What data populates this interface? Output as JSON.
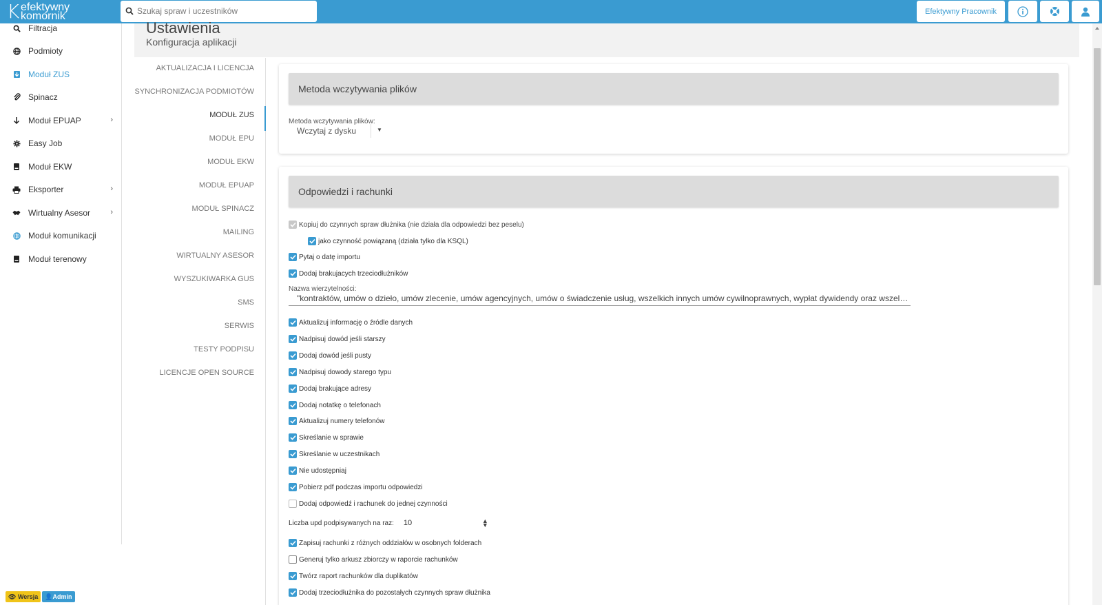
{
  "app": {
    "logo_line1": "efektywny",
    "logo_line2": "komornik",
    "search_placeholder": "Szukaj spraw i uczestników",
    "user_button": "Efektywny Pracownik",
    "accent_color": "#3a9bd1"
  },
  "sidebar": {
    "items": [
      {
        "label": "Filtracja",
        "icon": "search-icon"
      },
      {
        "label": "Podmioty",
        "icon": "globe-icon"
      },
      {
        "label": "Moduł ZUS",
        "icon": "import-icon",
        "active": true
      },
      {
        "label": "Spinacz",
        "icon": "paperclip-icon"
      },
      {
        "label": "Moduł EPUAP",
        "icon": "arrow-down-icon",
        "has_submenu": true
      },
      {
        "label": "Easy Job",
        "icon": "gear-icon"
      },
      {
        "label": "Moduł EKW",
        "icon": "book-icon"
      },
      {
        "label": "Eksporter",
        "icon": "printer-icon",
        "has_submenu": true
      },
      {
        "label": "Wirtualny Asesor",
        "icon": "handshake-icon",
        "has_submenu": true
      },
      {
        "label": "Moduł komunikacji",
        "icon": "network-icon"
      },
      {
        "label": "Moduł terenowy",
        "icon": "book-icon"
      }
    ],
    "badge_version": "Wersja",
    "badge_admin": "Admin"
  },
  "page": {
    "title": "Ustawienia",
    "subtitle": "Konfiguracja aplikacji"
  },
  "settings_nav": [
    "AKTUALIZACJA I LICENCJA",
    "SYNCHRONIZACJA PODMIOTÓW",
    "MODUŁ ZUS",
    "MODUŁ EPU",
    "MODUŁ EKW",
    "MODUŁ EPUAP",
    "MODUŁ SPINACZ",
    "MAILING",
    "WIRTUALNY ASESOR",
    "WYSZUKIWARKA GUS",
    "SMS",
    "SERWIS",
    "TESTY PODPISU",
    "LICENCJE OPEN SOURCE"
  ],
  "settings_nav_active": "MODUŁ ZUS",
  "card1": {
    "header": "Metoda wczytywania plików",
    "field_label": "Metoda wczytywania plików:",
    "field_value": "Wczytaj z dysku"
  },
  "card2": {
    "header": "Odpowiedzi i rachunki",
    "checkboxes_top": [
      {
        "label": "Kopiuj do czynnych spraw dłużnika (nie działa dla odpowiedzi bez peselu)",
        "state": "disabled-checked"
      },
      {
        "label": "jako czynność powiązaną (działa tylko dla KSQL)",
        "state": "checked"
      },
      {
        "label": "Pytaj o datę importu",
        "state": "checked"
      },
      {
        "label": "Dodaj brakujacych trzeciodłużników",
        "state": "checked"
      }
    ],
    "text_label": "Nazwa wierzytelności:",
    "text_value": "\"kontraktów, umów o dzieło, umów zlecenie, umów agencyjnych, umów o świadczenie usług, wszelkich innych umów cywilnoprawnych, wypłat dywidendy oraz wszelkich inny...",
    "checkboxes_mid": [
      {
        "label": "Aktualizuj informację o źródle danych",
        "state": "checked"
      },
      {
        "label": "Nadpisuj dowód jeśli starszy",
        "state": "checked"
      },
      {
        "label": "Dodaj dowód jeśli pusty",
        "state": "checked"
      },
      {
        "label": "Nadpisuj dowody starego typu",
        "state": "checked"
      },
      {
        "label": "Dodaj brakujące adresy",
        "state": "checked"
      },
      {
        "label": "Dodaj notatkę o telefonach",
        "state": "checked"
      },
      {
        "label": "Aktualizuj numery telefonów",
        "state": "checked"
      },
      {
        "label": "Skreślanie w sprawie",
        "state": "checked"
      },
      {
        "label": "Skreślanie w uczestnikach",
        "state": "checked"
      },
      {
        "label": "Nie udostępniaj",
        "state": "checked"
      },
      {
        "label": "Pobierz pdf podczas importu odpowiedzi",
        "state": "checked"
      },
      {
        "label": "Dodaj odpowiedź i rachunek do jednej czynności",
        "state": "unchecked"
      }
    ],
    "number_label": "Liczba upd podpisywanych na raz:",
    "number_value": "10",
    "checkboxes_bottom": [
      {
        "label": "Zapisuj rachunki z różnych oddziałów w osobnych folderach",
        "state": "checked"
      },
      {
        "label": "Generuj tylko arkusz zbiorczy w raporcie rachunków",
        "state": "unchecked"
      },
      {
        "label": "Twórz raport rachunków dla duplikatów",
        "state": "checked"
      },
      {
        "label": "Dodaj trzeciodłużnika do pozostałych czynnych spraw dłużnika",
        "state": "checked"
      }
    ]
  }
}
